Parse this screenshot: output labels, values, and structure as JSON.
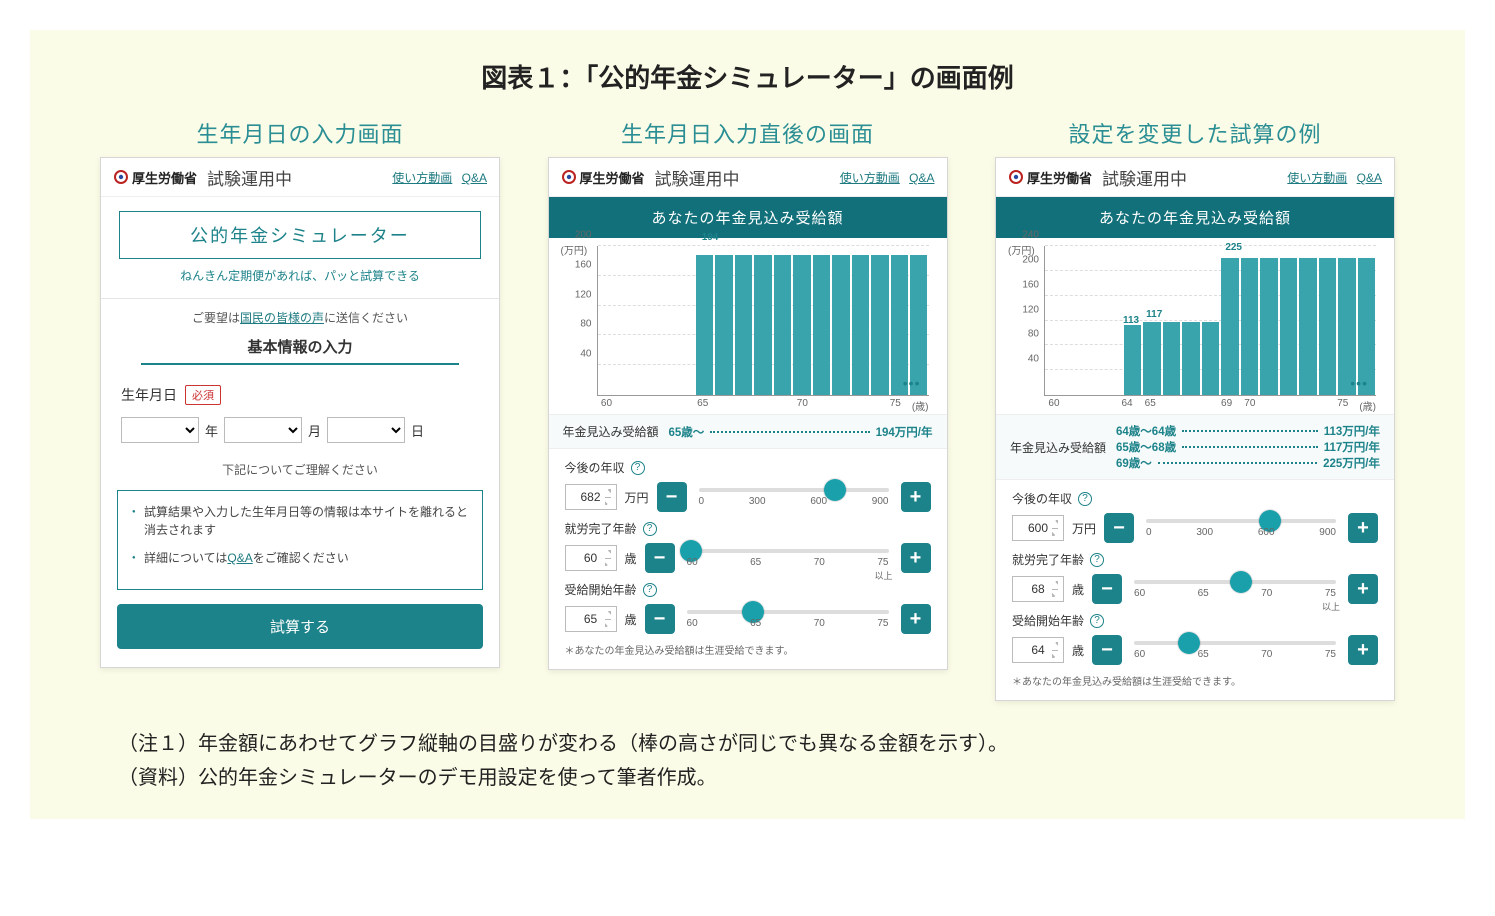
{
  "figure_title": "図表１：「公的年金シミュレーター」の画面例",
  "panels": {
    "p1_title": "生年月日の入力画面",
    "p2_title": "生年月日入力直後の画面",
    "p3_title": "設定を変更した試算の例"
  },
  "header": {
    "ministry": "厚生労働省",
    "trial": "試験運用中",
    "link_video": "使い方動画",
    "link_qa": "Q&A"
  },
  "panel1": {
    "app_title": "公的年金シミュレーター",
    "app_tagline": "ねんきん定期便があれば、パッと試算できる",
    "feedback_prefix": "ご要望は",
    "feedback_link": "国民の皆様の声",
    "feedback_suffix": "に送信ください",
    "section": "基本情報の入力",
    "dob_label": "生年月日",
    "required": "必須",
    "year_unit": "年",
    "month_unit": "月",
    "day_unit": "日",
    "understand": "下記についてご理解ください",
    "note1": "試算結果や入力した生年月日等の情報は本サイトを離れると消去されます",
    "note2_prefix": "詳細については",
    "note2_link": "Q&A",
    "note2_suffix": "をご確認ください",
    "button": "試算する"
  },
  "result_banner": "あなたの年金見込み受給額",
  "chart_common": {
    "ylabel": "(万円)",
    "x_unit": "(歳)",
    "estimate_label": "年金見込み受給額"
  },
  "panel2": {
    "estimate": {
      "range": "65歳～",
      "amount": "194万円/年"
    },
    "sliders": {
      "income": {
        "label": "今後の年収",
        "value": "682",
        "unit": "万円",
        "ticks": [
          "0",
          "300",
          "600",
          "900"
        ],
        "thumb_pct": 72
      },
      "work_end": {
        "label": "就労完了年齢",
        "value": "60",
        "unit": "歳",
        "ticks": [
          "60",
          "65",
          "70",
          "75"
        ],
        "ijou": "以上",
        "thumb_pct": 2
      },
      "start_age": {
        "label": "受給開始年齢",
        "value": "65",
        "unit": "歳",
        "ticks": [
          "60",
          "65",
          "70",
          "75"
        ],
        "thumb_pct": 33
      }
    },
    "footnote": "＊あなたの年金見込み受給額は生涯受給できます。"
  },
  "panel3": {
    "estimates": [
      {
        "range": "64歳～64歳",
        "amount": "113万円/年"
      },
      {
        "range": "65歳～68歳",
        "amount": "117万円/年"
      },
      {
        "range": "69歳～",
        "amount": "225万円/年"
      }
    ],
    "labels": {
      "l113": "113",
      "l117": "117",
      "l225": "225"
    },
    "sliders": {
      "income": {
        "label": "今後の年収",
        "value": "600",
        "unit": "万円",
        "ticks": [
          "0",
          "300",
          "600",
          "900"
        ],
        "thumb_pct": 65
      },
      "work_end": {
        "label": "就労完了年齢",
        "value": "68",
        "unit": "歳",
        "ticks": [
          "60",
          "65",
          "70",
          "75"
        ],
        "ijou": "以上",
        "thumb_pct": 53
      },
      "start_age": {
        "label": "受給開始年齢",
        "value": "64",
        "unit": "歳",
        "ticks": [
          "60",
          "65",
          "70",
          "75"
        ],
        "thumb_pct": 27
      }
    },
    "footnote": "＊あなたの年金見込み受給額は生涯受給できます。"
  },
  "notes": {
    "n1": "（注１）年金額にあわせてグラフ縦軸の目盛りが変わる（棒の高さが同じでも異なる金額を示す）。",
    "n2": "（資料）公的年金シミュレーターのデモ用設定を使って筆者作成。"
  },
  "chart_data": [
    {
      "panel": 2,
      "type": "bar",
      "xlabel": "歳",
      "ylabel": "万円",
      "ylim": [
        0,
        200
      ],
      "yticks": [
        0,
        40,
        80,
        120,
        160,
        200
      ],
      "x_range": [
        60,
        76
      ],
      "xticks": [
        60,
        65,
        70,
        75
      ],
      "series": [
        {
          "name": "年金見込み受給額",
          "x_start": 65,
          "x_end": 76,
          "value": 194
        }
      ],
      "annotations": [
        {
          "x": 65,
          "y": 194,
          "text": "194"
        }
      ]
    },
    {
      "panel": 3,
      "type": "bar",
      "xlabel": "歳",
      "ylabel": "万円",
      "ylim": [
        0,
        240
      ],
      "yticks": [
        0,
        40,
        80,
        120,
        160,
        200,
        240
      ],
      "x_range": [
        60,
        76
      ],
      "xticks": [
        60,
        64,
        65,
        69,
        70,
        75
      ],
      "series": [
        {
          "name": "64歳～64歳",
          "x_start": 64,
          "x_end": 64,
          "value": 113
        },
        {
          "name": "65歳～68歳",
          "x_start": 65,
          "x_end": 68,
          "value": 117
        },
        {
          "name": "69歳～",
          "x_start": 69,
          "x_end": 76,
          "value": 225
        }
      ],
      "annotations": [
        {
          "x": 64,
          "y": 113,
          "text": "113"
        },
        {
          "x": 65,
          "y": 117,
          "text": "117"
        },
        {
          "x": 69,
          "y": 225,
          "text": "225"
        }
      ]
    }
  ]
}
